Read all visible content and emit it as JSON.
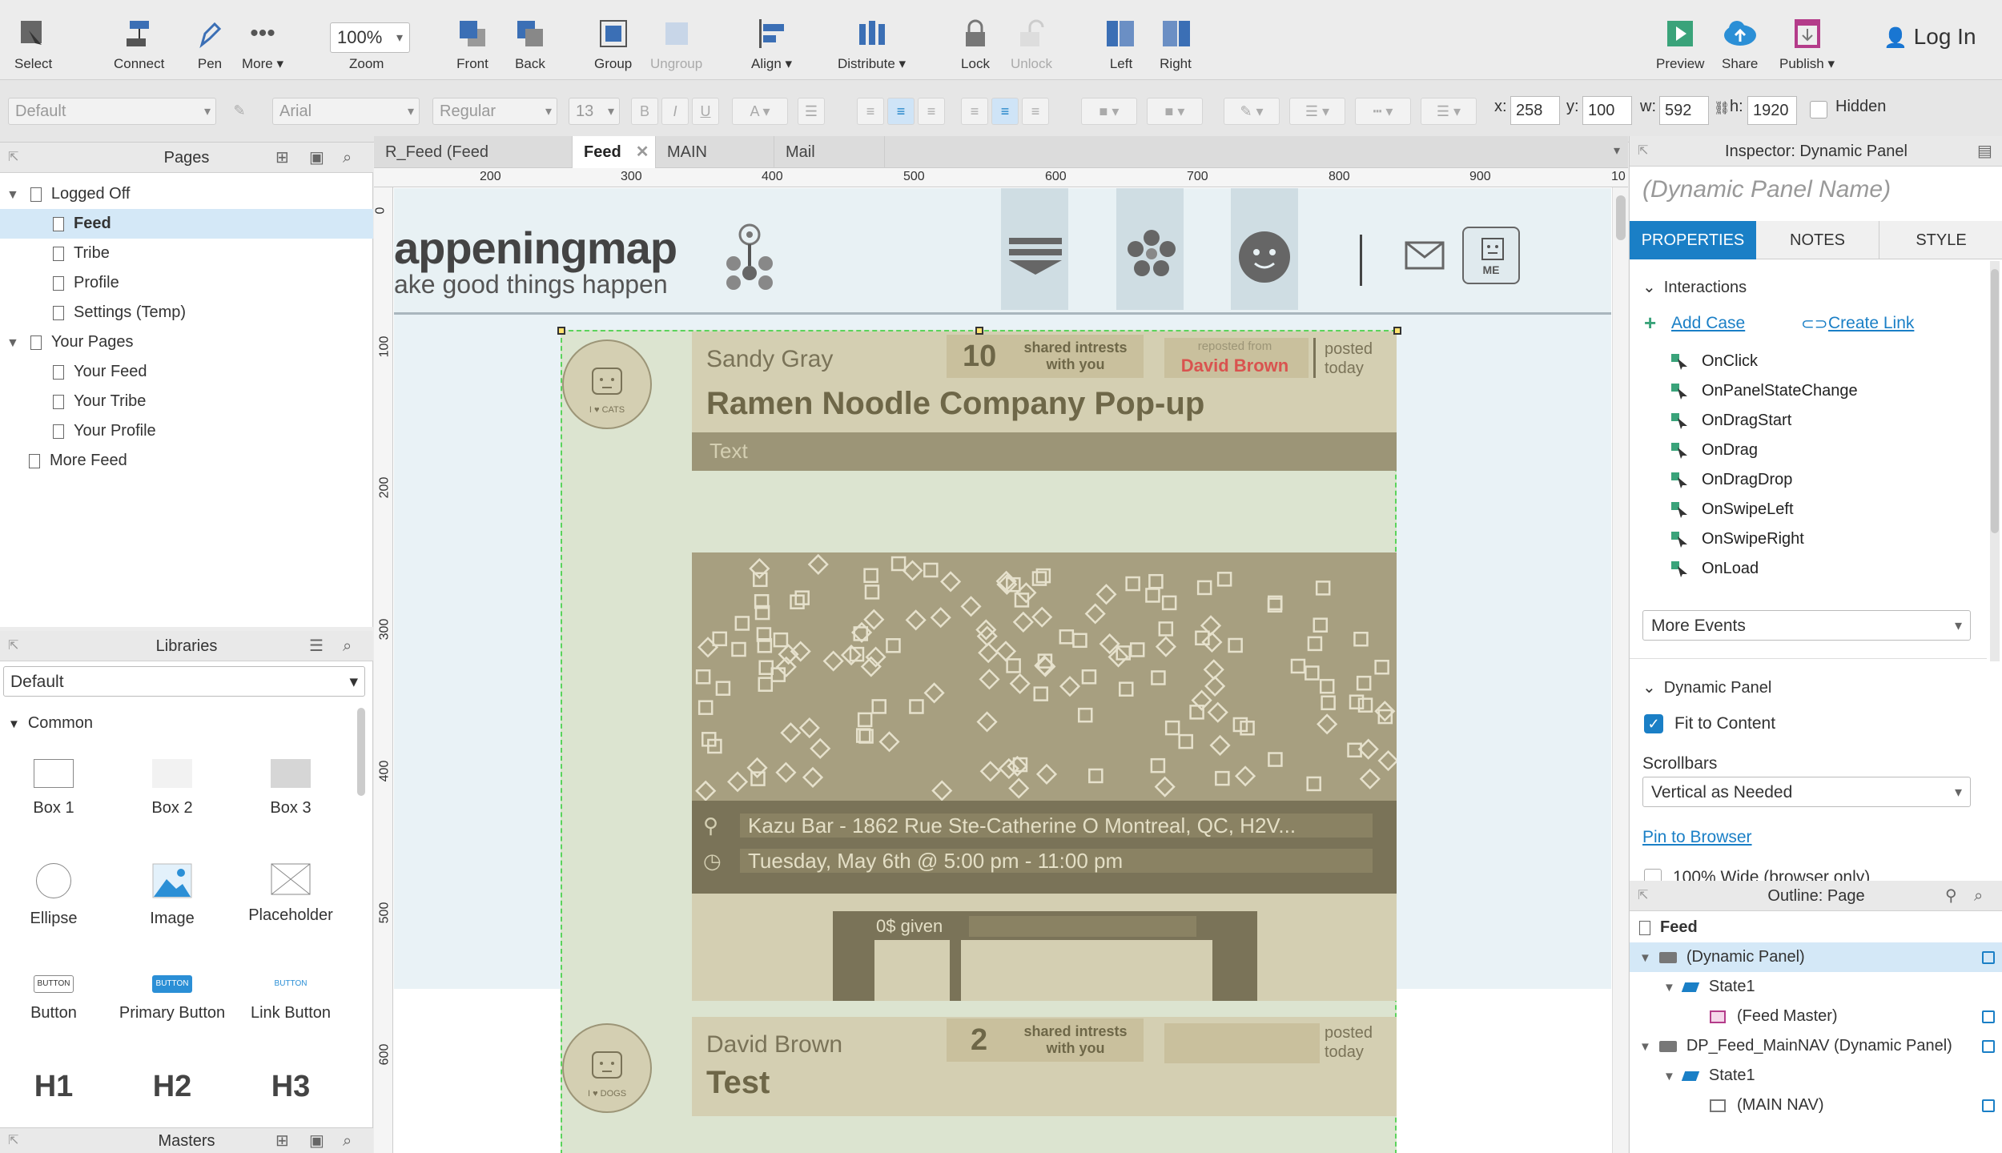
{
  "toolbar": {
    "select": "Select",
    "connect": "Connect",
    "pen": "Pen",
    "more": "More ▾",
    "zoom_value": "100%",
    "zoom": "Zoom",
    "front": "Front",
    "back": "Back",
    "group": "Group",
    "ungroup": "Ungroup",
    "align": "Align ▾",
    "distribute": "Distribute ▾",
    "lock": "Lock",
    "unlock": "Unlock",
    "left": "Left",
    "right": "Right",
    "preview": "Preview",
    "share": "Share",
    "publish": "Publish ▾",
    "login": "Log In"
  },
  "format": {
    "style": "Default",
    "font": "Arial",
    "weight": "Regular",
    "size": "13",
    "x_label": "x:",
    "x": "258",
    "y_label": "y:",
    "y": "100",
    "w_label": "w:",
    "w": "592",
    "h_label": "h:",
    "h": "1920",
    "hidden": "Hidden"
  },
  "pages": {
    "title": "Pages",
    "items": [
      {
        "label": "Logged Off"
      },
      {
        "label": "Feed"
      },
      {
        "label": "Tribe"
      },
      {
        "label": "Profile"
      },
      {
        "label": "Settings (Temp)"
      },
      {
        "label": "Your Pages"
      },
      {
        "label": "Your Feed"
      },
      {
        "label": "Your Tribe"
      },
      {
        "label": "Your Profile"
      },
      {
        "label": "More Feed"
      }
    ]
  },
  "libraries": {
    "title": "Libraries",
    "selected": "Default",
    "section": "Common",
    "widgets": [
      "Box 1",
      "Box 2",
      "Box 3",
      "Ellipse",
      "Image",
      "Placeholder",
      "Button",
      "Primary Button",
      "Link Button",
      "H1",
      "H2",
      "H3"
    ],
    "button_text": "BUTTON"
  },
  "masters": {
    "title": "Masters"
  },
  "tabs": [
    {
      "label": "R_Feed (Feed Master)"
    },
    {
      "label": "Feed"
    },
    {
      "label": "MAIN NAV"
    },
    {
      "label": "Mail Box"
    }
  ],
  "rulers": {
    "h": [
      "200",
      "300",
      "400",
      "500",
      "600",
      "700",
      "800",
      "900",
      "10"
    ],
    "v": [
      "0",
      "100",
      "200",
      "300",
      "400",
      "500",
      "600"
    ]
  },
  "design": {
    "logo_line1": "appeningmap",
    "logo_line2": "ake good things happen",
    "me": "ME",
    "post1": {
      "author": "Sandy Gray",
      "shared_count": "10",
      "shared_text": "shared intrests with you",
      "reposted_from": "reposted from",
      "repost_author": "David Brown",
      "posted": "posted today",
      "title": "Ramen Noodle Company Pop-up",
      "text": "Text",
      "avatar_label": "I ♥ CATS",
      "location": "Kazu Bar - 1862 Rue Ste-Catherine O Montreal, QC, H2V...",
      "time": "Tuesday, May 6th @ 5:00 pm - 11:00 pm",
      "given": "0$ given"
    },
    "post2": {
      "author": "David Brown",
      "shared_count": "2",
      "shared_text": "shared intrests with you",
      "posted": "posted today",
      "title": "Test",
      "avatar_label": "I ♥ DOGS"
    }
  },
  "inspector": {
    "title": "Inspector: Dynamic Panel",
    "name_placeholder": "(Dynamic Panel Name)",
    "tabs": [
      "PROPERTIES",
      "NOTES",
      "STYLE"
    ],
    "interactions": "Interactions",
    "add_case": "Add Case",
    "create_link": "Create Link",
    "events": [
      "OnClick",
      "OnPanelStateChange",
      "OnDragStart",
      "OnDrag",
      "OnDragDrop",
      "OnSwipeLeft",
      "OnSwipeRight",
      "OnLoad"
    ],
    "more_events": "More Events",
    "dynamic_panel": "Dynamic Panel",
    "fit_to_content": "Fit to Content",
    "scrollbars": "Scrollbars",
    "scrollbars_value": "Vertical as Needed",
    "pin_to_browser": "Pin to Browser",
    "wide": "100% Wide (browser only)"
  },
  "outline": {
    "title": "Outline: Page",
    "rows": [
      {
        "label": "Feed"
      },
      {
        "label": "(Dynamic Panel)"
      },
      {
        "label": "State1"
      },
      {
        "label": "(Feed Master)"
      },
      {
        "label": "DP_Feed_MainNAV (Dynamic Panel)"
      },
      {
        "label": "State1"
      },
      {
        "label": "(MAIN NAV)"
      }
    ]
  },
  "colors": {
    "accent": "#1a7fc6",
    "selection": "#d4e8f7",
    "repost": "#d9534f"
  }
}
